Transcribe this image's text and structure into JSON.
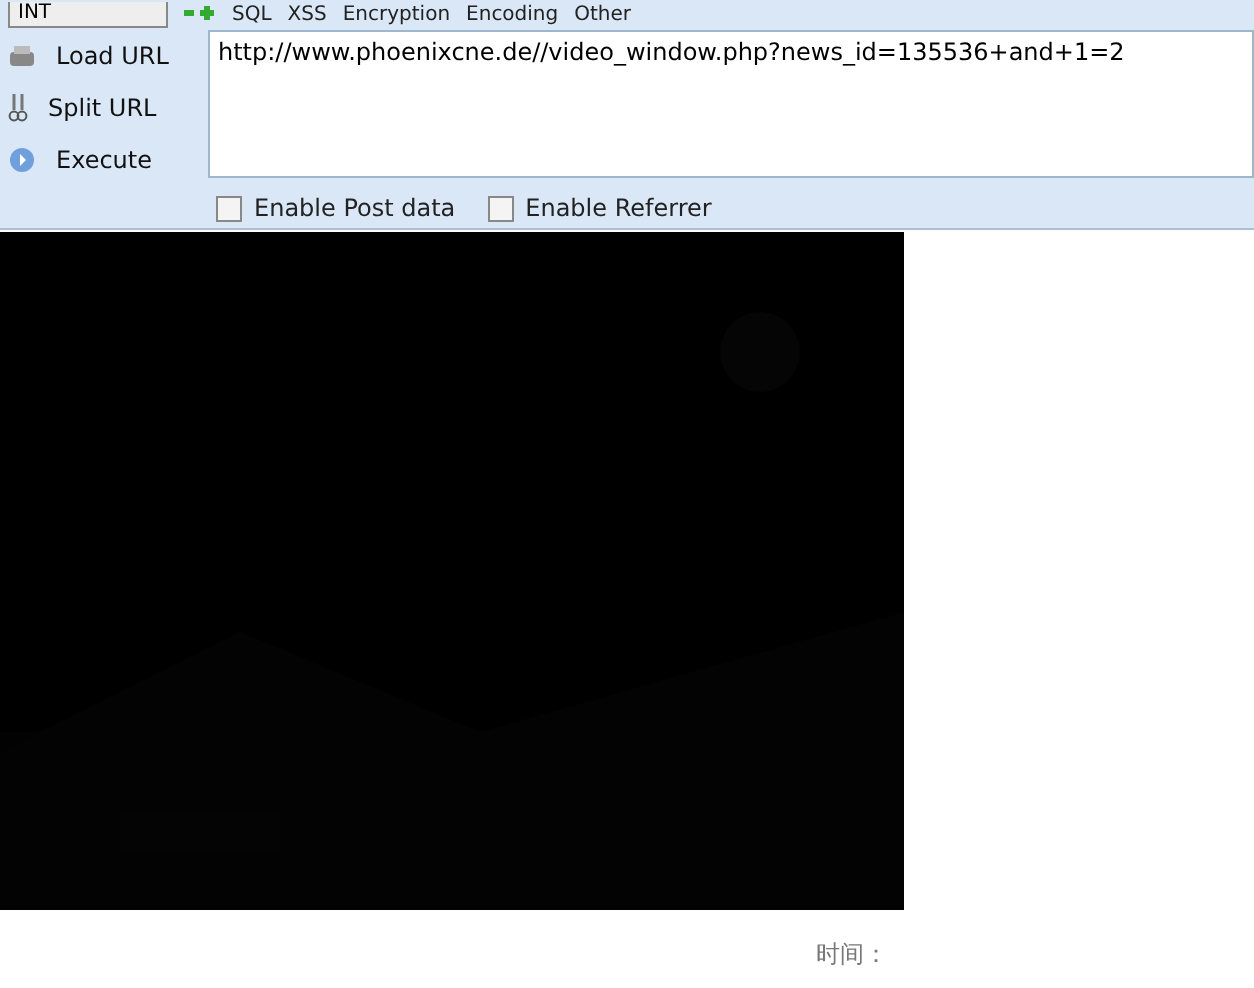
{
  "toolbar": {
    "select": "INT",
    "menus": [
      {
        "label": "SQL"
      },
      {
        "label": "XSS"
      },
      {
        "label": "Encryption"
      },
      {
        "label": "Encoding"
      },
      {
        "label": "Other"
      }
    ]
  },
  "actions": [
    {
      "kind": "load",
      "label": "Load URL"
    },
    {
      "kind": "split",
      "label": "Split URL"
    },
    {
      "kind": "execute",
      "label": "Execute"
    }
  ],
  "url": "http://www.phoenixcne.de//video_window.php?news_id=135536+and+1=2",
  "options": [
    {
      "label": "Enable Post data",
      "checked": false
    },
    {
      "label": "Enable Referrer",
      "checked": false
    }
  ],
  "time_label": "时间："
}
